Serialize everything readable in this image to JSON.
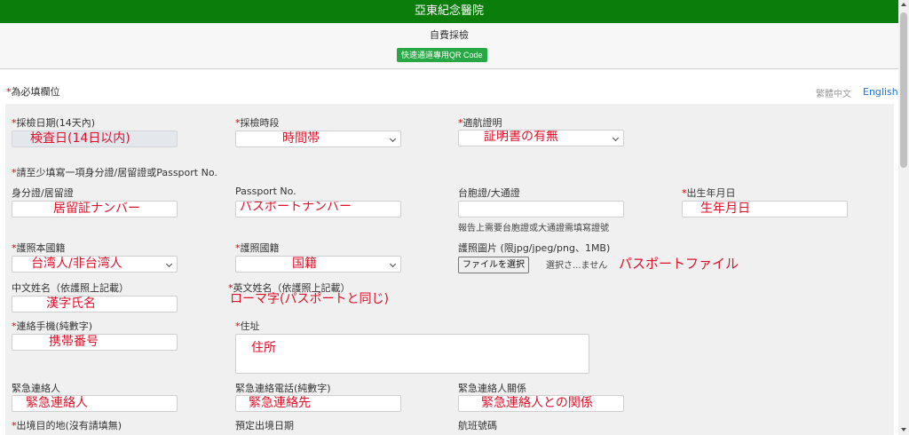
{
  "header": {
    "title": "亞東紀念醫院",
    "subtitle": "自費採檢",
    "qr_button": "快速通道專用QR Code"
  },
  "required_note": {
    "star": "*",
    "text": "為必填欄位"
  },
  "language": {
    "zh": "繁體中文",
    "en": "English"
  },
  "form": {
    "date": {
      "label": "採檢日期(14天內)",
      "value": "検査日(14日以内)"
    },
    "period": {
      "label": "採檢時段",
      "value": "時間帯"
    },
    "flight_cert": {
      "label": "適航證明",
      "value": "証明書の有無"
    },
    "id_notice": {
      "label": "請至少填寫一項身分證/居留證或Passport No."
    },
    "resident_id": {
      "label": "身分證/居留證",
      "value": "居留証ナンバー"
    },
    "passport_no": {
      "label": "Passport No.",
      "value": "パスポートナンバー"
    },
    "taiwan_pass": {
      "label": "台胞證/大通證",
      "value": "",
      "hint": "報告上需要台胞證或大通證需填寫證號"
    },
    "birthday": {
      "label": "出生年月日",
      "value": "生年月日"
    },
    "passport_origin": {
      "label": "護照本國籍",
      "value": "台湾人/非台湾人"
    },
    "nationality": {
      "label": "護照國籍",
      "value": "国籍"
    },
    "passport_photo": {
      "label": "護照圖片 (限jpg/jpeg/png、1MB)",
      "button": "ファイルを選択",
      "status": "選択さ...ません",
      "note": "パスポートファイル"
    },
    "chinese_name": {
      "label": "中文姓名（依護照上記載）",
      "value": "漢字氏名"
    },
    "english_name": {
      "label": "英文姓名（依護照上記載）",
      "value": "ローマ字(パスポートと同じ)"
    },
    "mobile": {
      "label": "連絡手機(純數字)",
      "value": "携帯番号"
    },
    "address": {
      "label": "住址",
      "value": "住所"
    },
    "emergency_contact": {
      "label": "緊急連絡人",
      "value": "緊急連絡人"
    },
    "emergency_phone": {
      "label": "緊急連絡電話(純數字)",
      "value": "緊急連絡先"
    },
    "emergency_relation": {
      "label": "緊急連絡人關係",
      "value": "緊急連絡人との関係"
    },
    "destination": {
      "label": "出境目的地(沒有請填無)"
    },
    "departure_date": {
      "label": "預定出境日期"
    },
    "flight_no": {
      "label": "航班號碼"
    }
  }
}
